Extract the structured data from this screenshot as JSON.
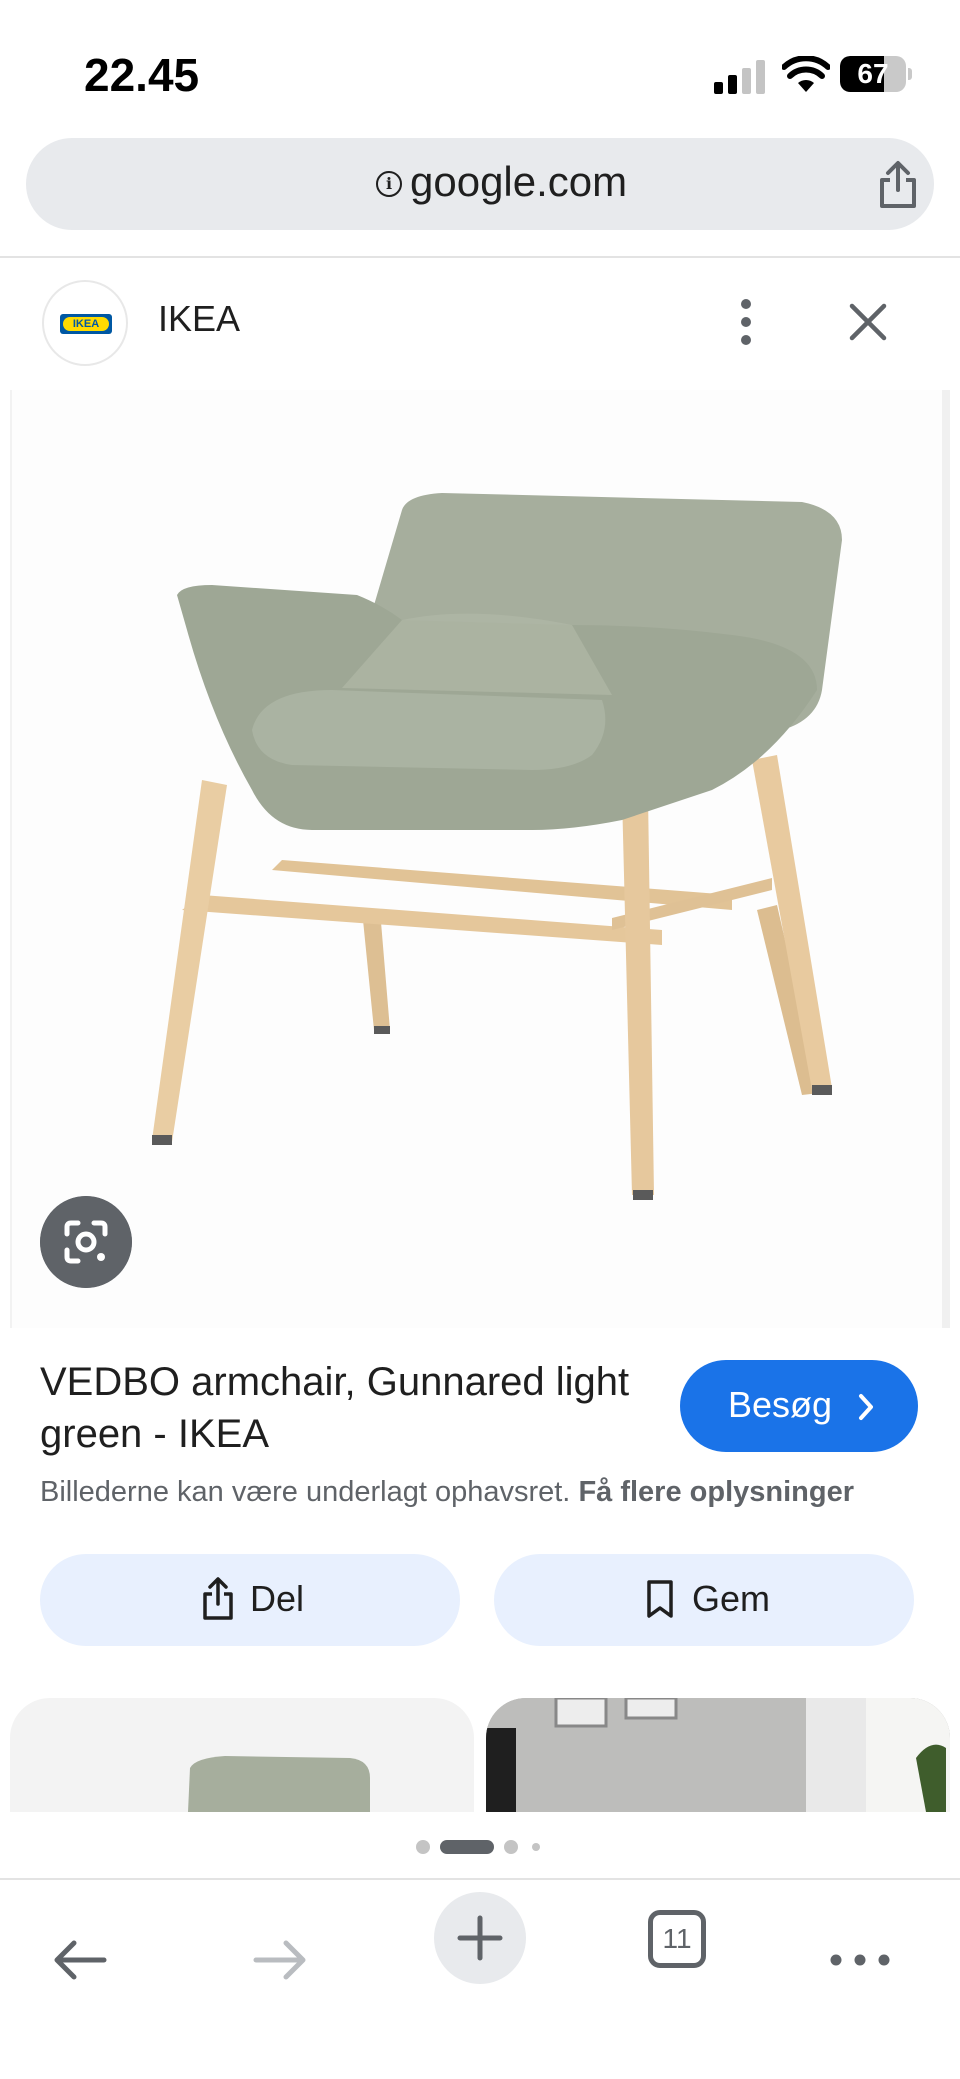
{
  "status_bar": {
    "time": "22.45",
    "battery": "67",
    "battery_level": 0.67
  },
  "url_bar": {
    "url": "google.com"
  },
  "site": {
    "name": "IKEA",
    "logo_text": "IKEA"
  },
  "product": {
    "title": "VEDBO armchair, Gunnared light green - IKEA",
    "visit_label": "Besøg",
    "copyright_text": "Billederne kan være underlagt ophavsret.",
    "copyright_link": "Få flere oplysninger"
  },
  "actions": {
    "share_label": "Del",
    "save_label": "Gem"
  },
  "toolbar": {
    "tabs_count": "11"
  },
  "colors": {
    "accent": "#1a73e8",
    "button_tint": "#e8f0fe",
    "chair_fabric": "#a3ac9b",
    "chair_wood": "#e6c99f"
  },
  "icons": [
    "info-icon",
    "share-icon",
    "more-vert-icon",
    "close-icon",
    "lens-icon",
    "chevron-right-icon",
    "bookmark-icon",
    "back-arrow-icon",
    "forward-arrow-icon",
    "plus-icon",
    "tabs-icon",
    "more-horiz-icon"
  ]
}
